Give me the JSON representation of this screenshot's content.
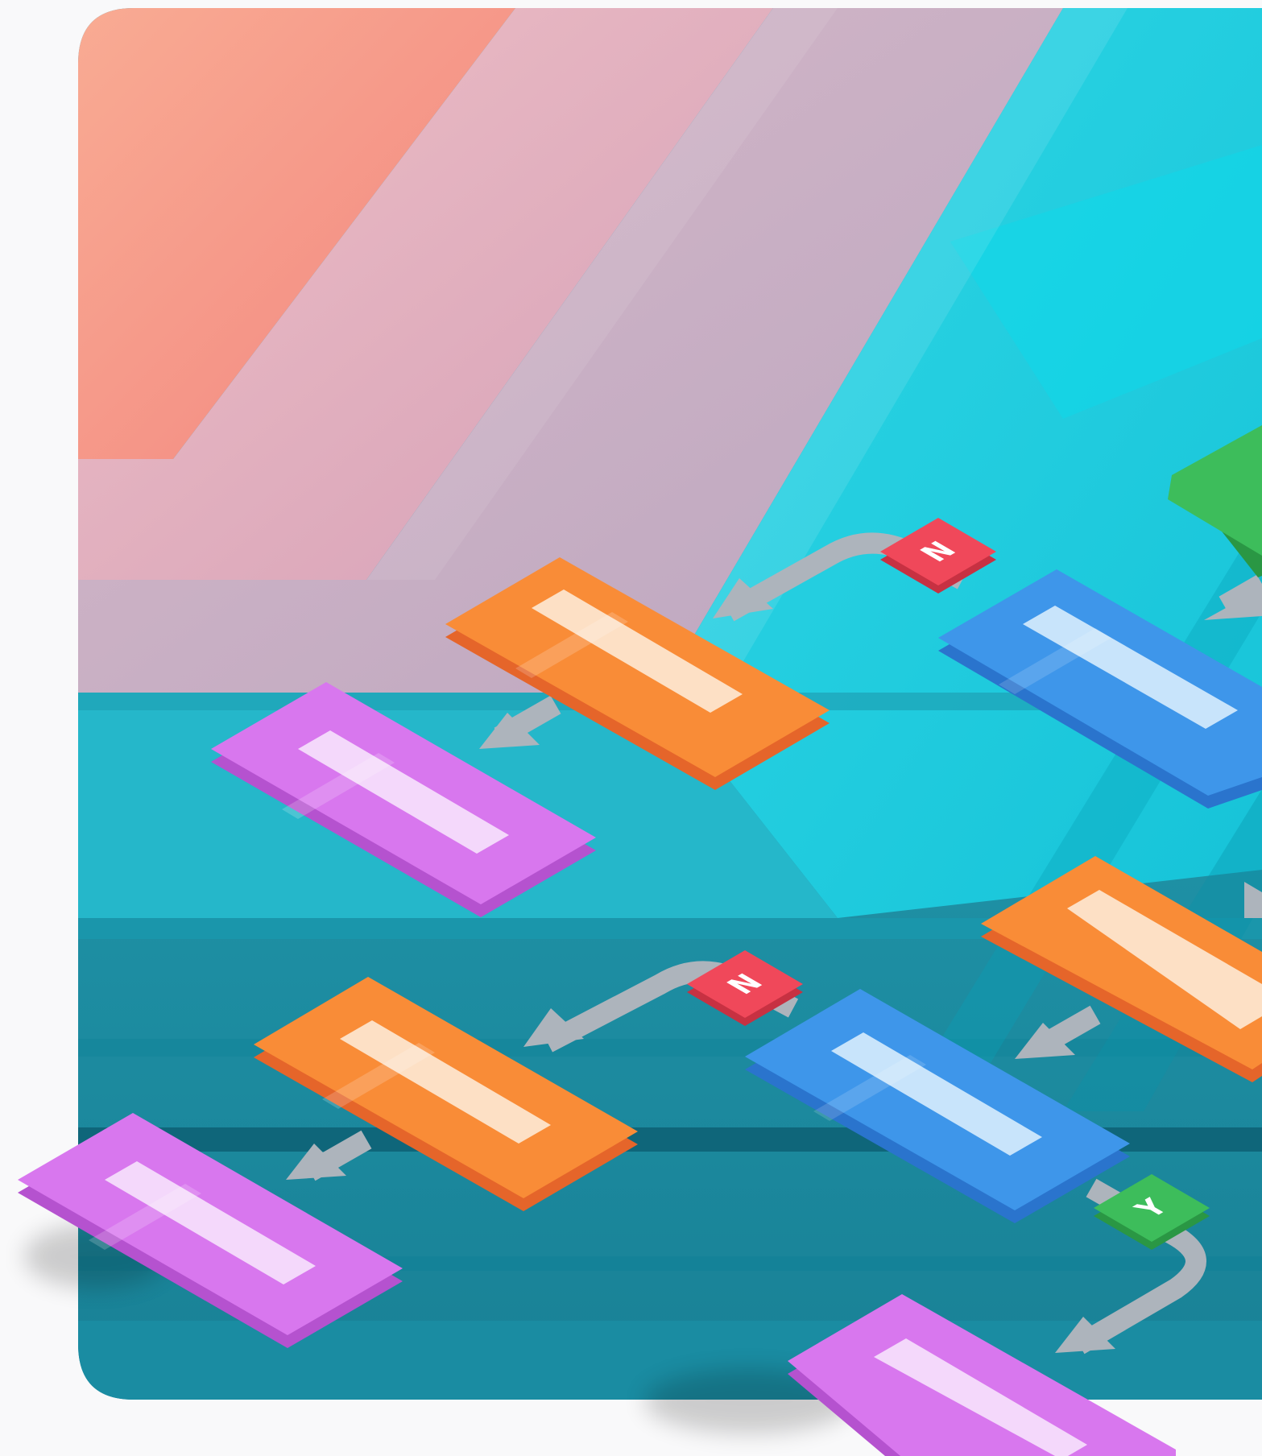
{
  "colors": {
    "canvas": "#f9f9fa",
    "coral": "#f6988f",
    "pink": "#e2b1c4",
    "mauve": "#c7b1c6",
    "cyan": "#1fcfe0",
    "teal": "#21a9bd",
    "deep_teal": "#137d92",
    "orange": "#f98c37",
    "orange_side": "#e5652a",
    "blue": "#3e96ea",
    "blue_side": "#2a74cd",
    "purple": "#d877ee",
    "purple_side": "#b552cf",
    "green": "#3dbd5b",
    "green_side": "#2a9744",
    "red": "#f0485a",
    "red_side": "#c73142",
    "arrow": "#adb4bc"
  },
  "decisions": [
    {
      "id": "upper-no",
      "label": "N",
      "color": "red"
    },
    {
      "id": "lower-no",
      "label": "N",
      "color": "red"
    },
    {
      "id": "lower-yes",
      "label": "Y",
      "color": "green"
    }
  ],
  "icons": {
    "arrow": "arrow-icon"
  }
}
